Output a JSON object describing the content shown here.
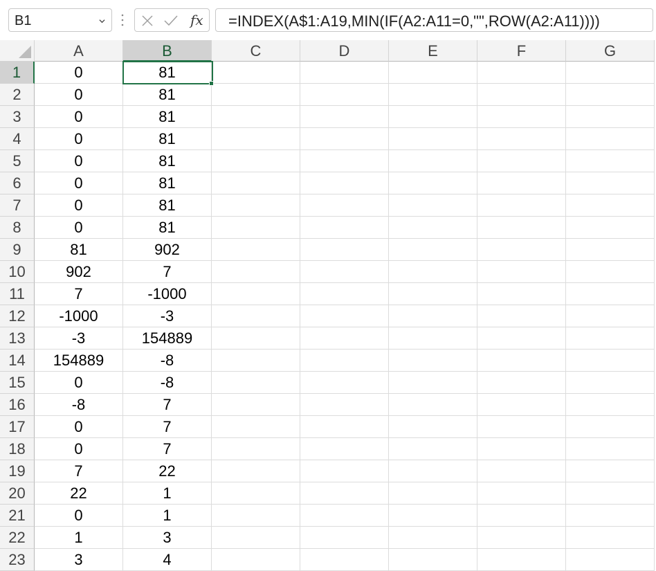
{
  "name_box": {
    "value": "B1"
  },
  "formula_bar": {
    "formula": "=INDEX(A$1:A19,MIN(IF(A2:A11=0,\"\",ROW(A2:A11))))"
  },
  "columns": [
    "A",
    "B",
    "C",
    "D",
    "E",
    "F",
    "G"
  ],
  "selected_column": "B",
  "selected_row": "1",
  "rows": [
    {
      "n": "1",
      "a": "0",
      "b": "81"
    },
    {
      "n": "2",
      "a": "0",
      "b": "81"
    },
    {
      "n": "3",
      "a": "0",
      "b": "81"
    },
    {
      "n": "4",
      "a": "0",
      "b": "81"
    },
    {
      "n": "5",
      "a": "0",
      "b": "81"
    },
    {
      "n": "6",
      "a": "0",
      "b": "81"
    },
    {
      "n": "7",
      "a": "0",
      "b": "81"
    },
    {
      "n": "8",
      "a": "0",
      "b": "81"
    },
    {
      "n": "9",
      "a": "81",
      "b": "902"
    },
    {
      "n": "10",
      "a": "902",
      "b": "7"
    },
    {
      "n": "11",
      "a": "7",
      "b": "-1000"
    },
    {
      "n": "12",
      "a": "-1000",
      "b": "-3"
    },
    {
      "n": "13",
      "a": "-3",
      "b": "154889"
    },
    {
      "n": "14",
      "a": "154889",
      "b": "-8"
    },
    {
      "n": "15",
      "a": "0",
      "b": "-8"
    },
    {
      "n": "16",
      "a": "-8",
      "b": "7"
    },
    {
      "n": "17",
      "a": "0",
      "b": "7"
    },
    {
      "n": "18",
      "a": "0",
      "b": "7"
    },
    {
      "n": "19",
      "a": "7",
      "b": "22"
    },
    {
      "n": "20",
      "a": "22",
      "b": "1"
    },
    {
      "n": "21",
      "a": "0",
      "b": "1"
    },
    {
      "n": "22",
      "a": "1",
      "b": "3"
    },
    {
      "n": "23",
      "a": "3",
      "b": "4"
    }
  ],
  "icons": {
    "name_box_dropdown": "chevron-down-icon",
    "cancel": "x-icon",
    "enter": "check-icon",
    "insert_function": "fx-icon"
  },
  "colors": {
    "accent": "#217346",
    "header_bg": "#f3f3f3",
    "selected_header_bg": "#d2d2d2"
  }
}
